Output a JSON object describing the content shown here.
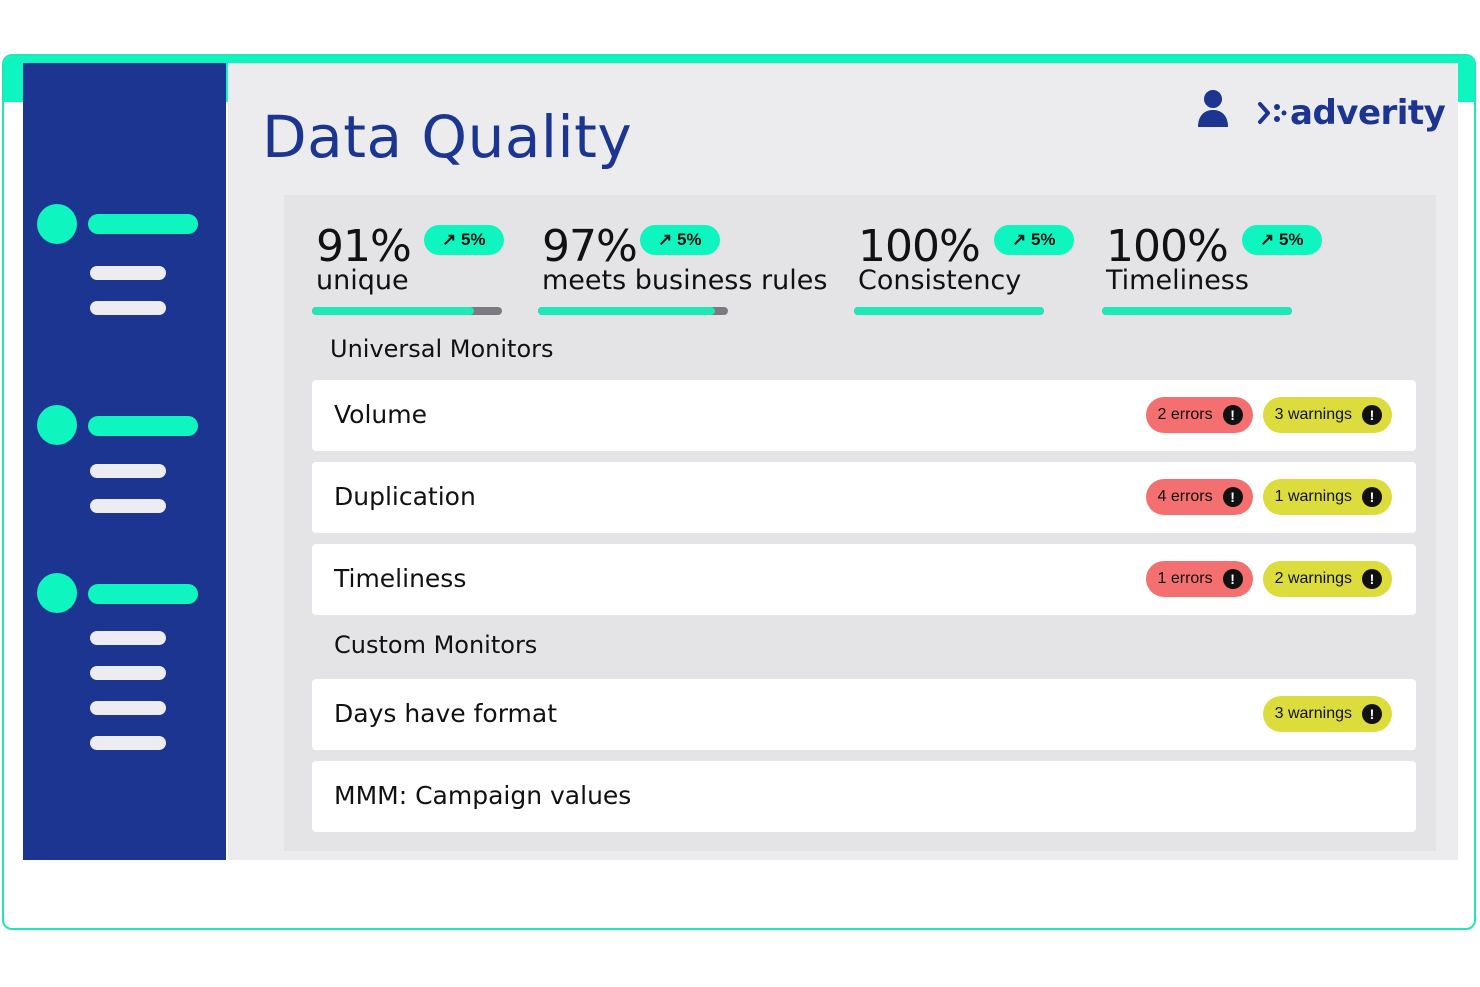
{
  "page": {
    "title": "Data Quality"
  },
  "brand": {
    "name": "adverity"
  },
  "metrics": [
    {
      "value": "91%",
      "label": "unique",
      "trend": "↗ 5%",
      "fill": 0.85
    },
    {
      "value": "97%",
      "label": "meets business rules",
      "trend": "↗ 5%",
      "fill": 0.93
    },
    {
      "value": "100%",
      "label": "Consistency",
      "trend": "↗ 5%",
      "fill": 1.0
    },
    {
      "value": "100%",
      "label": "Timeliness",
      "trend": "↗ 5%",
      "fill": 1.0
    }
  ],
  "sections": {
    "universal": "Universal Monitors",
    "custom": "Custom Monitors"
  },
  "monitors": {
    "volume": {
      "name": "Volume",
      "errors": "2 errors",
      "warnings": "3 warnings"
    },
    "duplication": {
      "name": "Duplication",
      "errors": "4 errors",
      "warnings": "1 warnings"
    },
    "timeliness": {
      "name": "Timeliness",
      "errors": "1 errors",
      "warnings": "2 warnings"
    },
    "days_format": {
      "name": "Days have format",
      "warnings": "3 warnings"
    },
    "mmm_campaign": {
      "name": "MMM: Campaign values"
    }
  },
  "icons": {
    "alert": "!"
  },
  "colors": {
    "accent": "#0ff5bf",
    "brand": "#1b3590",
    "error": "#f47070",
    "warning": "#dcdc3c"
  }
}
